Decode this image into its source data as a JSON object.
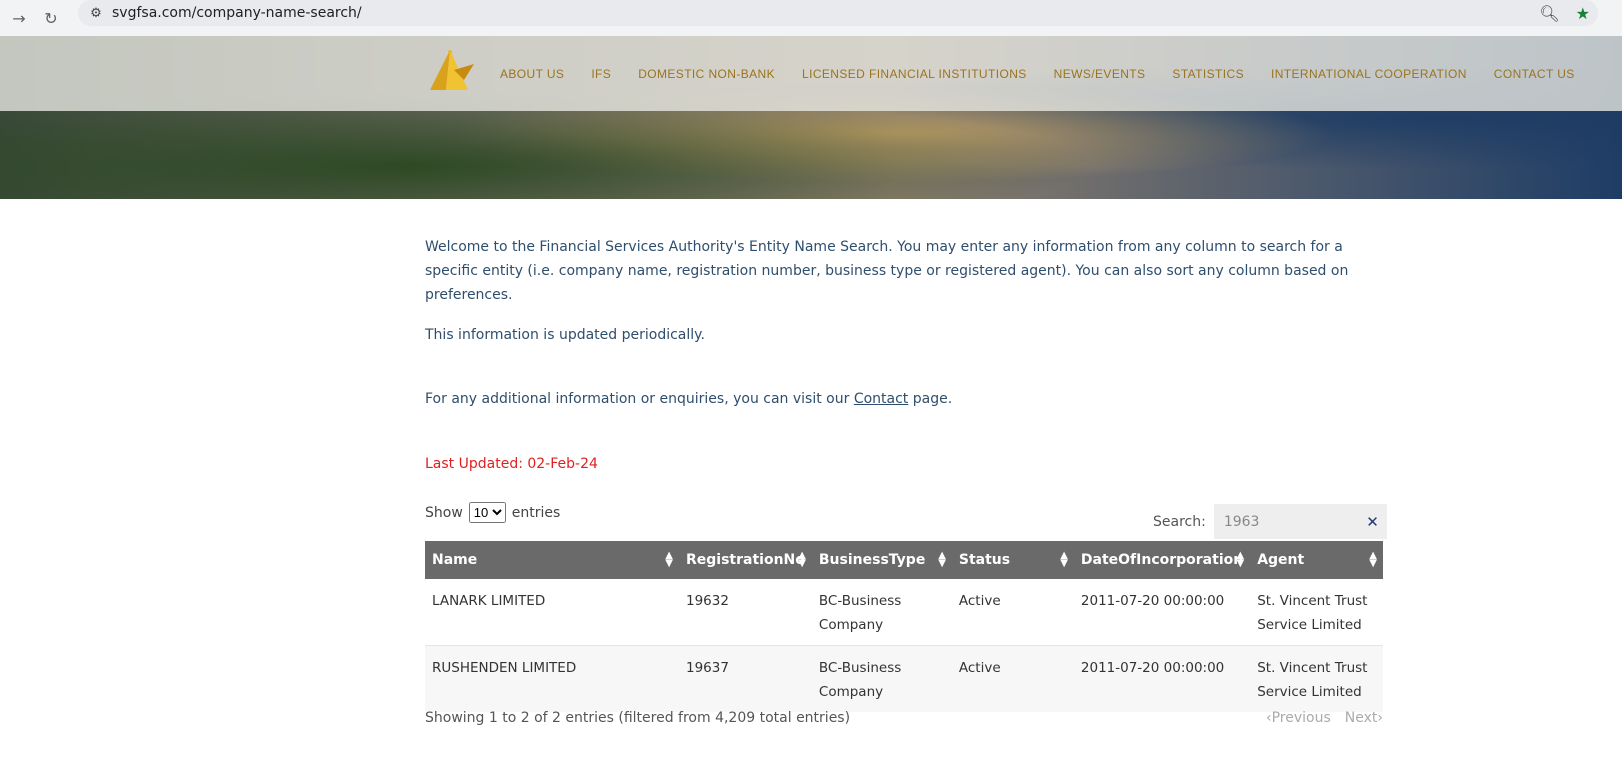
{
  "browser": {
    "url": "svgfsa.com/company-name-search/"
  },
  "nav": {
    "items": [
      "ABOUT US",
      "IFS",
      "DOMESTIC NON-BANK",
      "LICENSED FINANCIAL INSTITUTIONS",
      "NEWS/EVENTS",
      "STATISTICS",
      "INTERNATIONAL COOPERATION",
      "CONTACT US"
    ]
  },
  "intro": {
    "welcome": "Welcome to the Financial Services Authority's Entity Name Search. You may enter any information from any column to search for a specific entity (i.e. company name, registration number, business type or registered agent). You can also sort any column based on preferences.",
    "periodic": "This information is updated periodically.",
    "enquiry_prefix": "For any additional information or enquiries, you can visit our ",
    "contact_link": "Contact",
    "enquiry_suffix": " page.",
    "last_updated": "Last Updated:  02-Feb-24"
  },
  "controls": {
    "show_label": "Show",
    "entries_label": "entries",
    "page_size": "10",
    "search_label": "Search:",
    "search_value": "1963"
  },
  "table": {
    "headers": [
      "Name",
      "RegistrationNo",
      "BusinessType",
      "Status",
      "DateOfIncorporation",
      "Agent"
    ],
    "rows": [
      [
        "LANARK LIMITED",
        "19632",
        "BC-Business Company",
        "Active",
        "2011-07-20 00:00:00",
        "St. Vincent Trust Service Limited"
      ],
      [
        "RUSHENDEN LIMITED",
        "19637",
        "BC-Business Company",
        "Active",
        "2011-07-20 00:00:00",
        "St. Vincent Trust Service Limited"
      ]
    ]
  },
  "footer": {
    "info": "Showing 1 to 2 of 2 entries (filtered from 4,209 total entries)",
    "previous": "Previous",
    "next": "Next"
  },
  "colors": {
    "nav_text": "#9a7420",
    "body_text": "#2e4e6e",
    "updated_text": "#e02020",
    "header_bg": "#6a6a6a"
  }
}
